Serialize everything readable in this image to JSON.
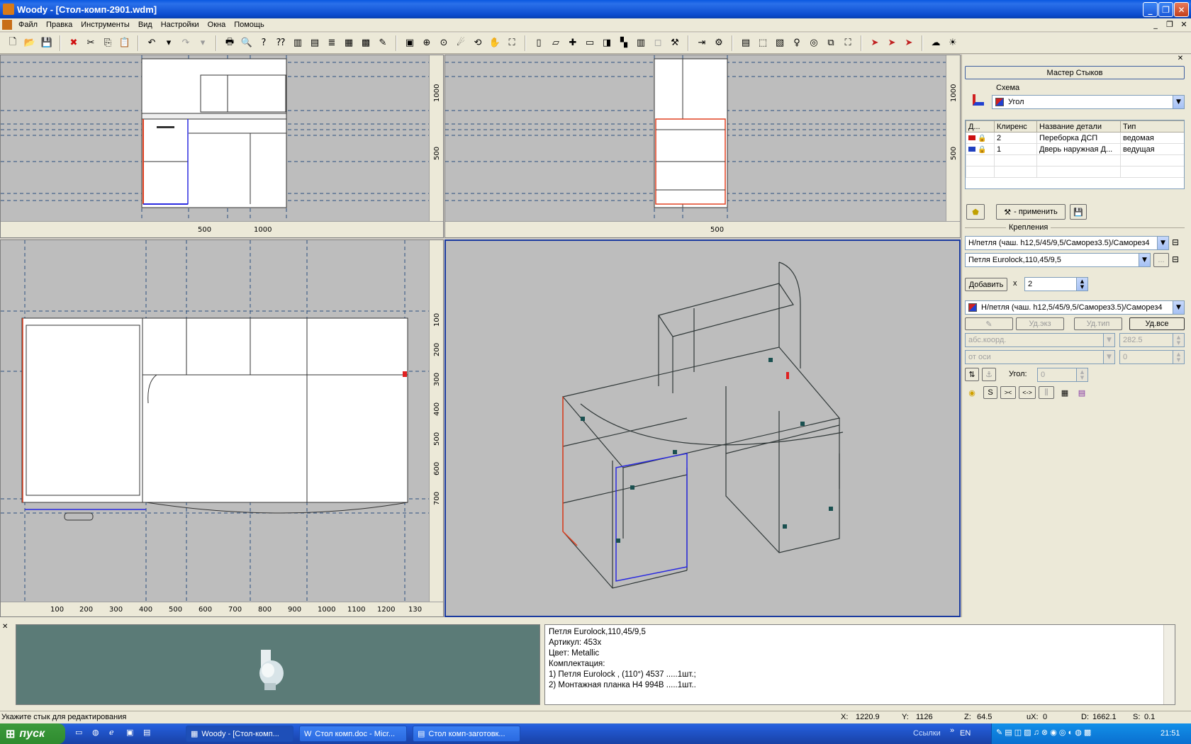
{
  "window": {
    "title": "Woody - [Стол-комп-2901.wdm]"
  },
  "menu": [
    "Файл",
    "Правка",
    "Инструменты",
    "Вид",
    "Настройки",
    "Окна",
    "Помощь"
  ],
  "viewports": {
    "front": {
      "v_ticks": [
        "1000",
        "500"
      ],
      "h_ticks": [
        "500",
        "1000"
      ]
    },
    "side": {
      "v_ticks": [
        "1000",
        "500"
      ],
      "h_ticks": [
        "500"
      ]
    },
    "top": {
      "v_ticks": [
        "100",
        "200",
        "300",
        "400",
        "500",
        "600",
        "700"
      ],
      "h_ticks": [
        "100",
        "200",
        "300",
        "400",
        "500",
        "600",
        "700",
        "800",
        "900",
        "1000",
        "1100",
        "1200",
        "130"
      ]
    }
  },
  "panel": {
    "header": "Мастер Стыков",
    "schema_label": "Схема",
    "schema_value": "Угол",
    "table": {
      "headers": [
        "Д...",
        "Клиренс",
        "Название детали",
        "Тип"
      ],
      "rows": [
        {
          "clearance": "2",
          "name": "Переборка ДСП",
          "type": "ведомая",
          "color": "#cc1010"
        },
        {
          "clearance": "1",
          "name": "Дверь наружная Д...",
          "type": "ведущая",
          "color": "#2040c0"
        }
      ]
    },
    "apply_label": "- применить",
    "fastenings_label": "Крепления",
    "fastening1": "Н/петля (чаш. h12,5/45/9,5/Саморез3.5)/Саморез4",
    "fastening2": "Петля Eurolock,110,45/9,5",
    "ellipsis": "...",
    "add_label": "Добавить",
    "times": "x",
    "count": "2",
    "fastening3": "Н/петля (чаш. h12,5/45/9,5/Саморез3.5)/Саморез4",
    "del_copy": "Уд.экз",
    "del_type": "Уд.тип",
    "del_all": "Уд.все",
    "coord_mode": "абс.коорд.",
    "coord_value": "282.5",
    "axis_mode": "от оси",
    "axis_value": "0",
    "angle_label": "Угол:",
    "angle_value": "0",
    "s_label": "S",
    "b1": "><",
    "b2": "<->"
  },
  "info": {
    "lines": [
      "Петля Eurolock,110,45/9,5",
      "Артикул: 453x",
      "Цвет: Metallic",
      "Комплектация:",
      "1) Петля Eurolock , (110°) 4537 .....1шт.;",
      "2) Монтажная планка H4 994B .....1шт.."
    ]
  },
  "status": {
    "message": "Укажите стык для редактирования",
    "x_label": "X:",
    "x": "1220.9",
    "y_label": "Y:",
    "y": "1126",
    "z_label": "Z:",
    "z": "64.5",
    "ux_label": "uX:",
    "ux": "0",
    "d_label": "D:",
    "d": "1662.1",
    "s_label": "S:",
    "s": "0.1"
  },
  "taskbar": {
    "start": "пуск",
    "tasks": [
      "Woody - [Стол-комп...",
      "Стол комп.doc - Micr...",
      "Стол комп-заготовк..."
    ],
    "links": "Ссылки",
    "lang": "EN",
    "clock": "21:51"
  },
  "colors": {
    "accent": "#0a58e0",
    "selected_red": "#e04020",
    "selected_blue": "#2a2ae0",
    "viewport_bg": "#bdbdbd"
  }
}
